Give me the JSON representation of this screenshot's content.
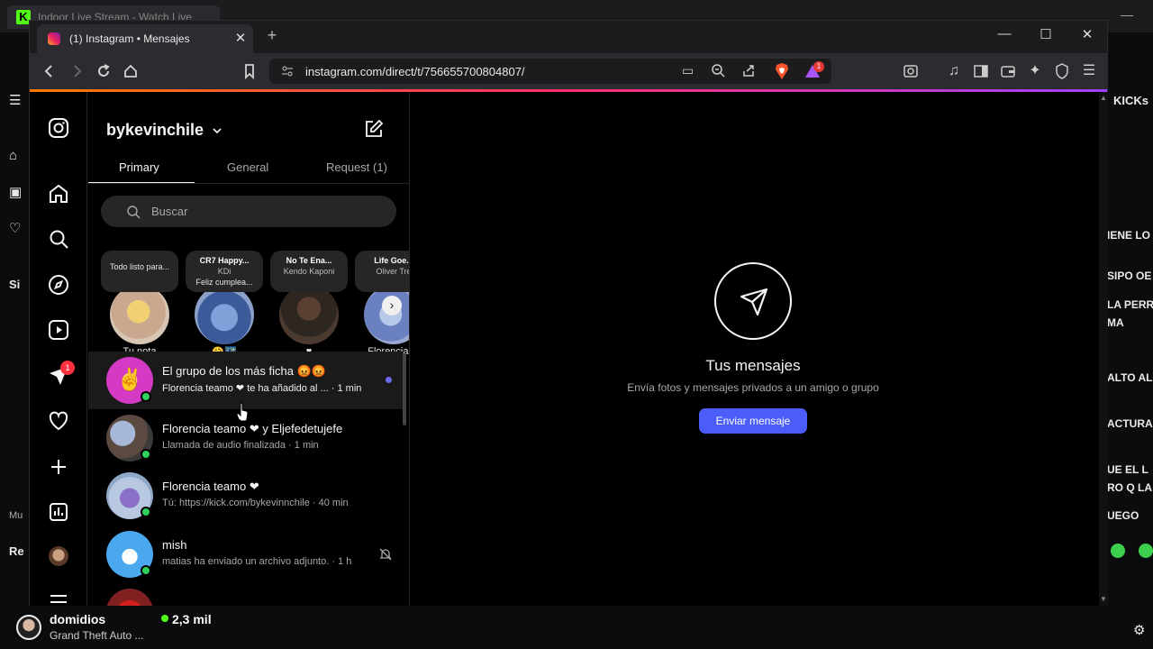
{
  "background": {
    "tab_title": "Indoor Live Stream - Watch Live",
    "tab_logo": "K",
    "chat_lines": [
      "KICKs",
      "IENE LO",
      "SIPO OE",
      "LA PERR",
      "MA",
      "ALTO AL",
      "ACTURA",
      "UE EL L",
      "RO Q LA",
      "UEGO"
    ],
    "left_labels": [
      "Si",
      "Mu",
      "Re"
    ],
    "streamer": {
      "name": "domidios",
      "game": "Grand Theft Auto ...",
      "viewers": "2,3 mil"
    },
    "accent": "#53fc18"
  },
  "browser": {
    "tab_title": "(1) Instagram • Mensajes",
    "url": "instagram.com/direct/t/756655700804807/",
    "notification_badge": "1"
  },
  "instagram": {
    "username": "bykevinchile",
    "tabs": [
      "Primary",
      "General",
      "Request (1)"
    ],
    "search_placeholder": "Buscar",
    "rail_badge": "1",
    "notes": [
      {
        "title": "Todo listo para...",
        "sub": "",
        "extra": "",
        "label": "Tu nota"
      },
      {
        "title": "CR7 Happy...",
        "sub": "KDi",
        "extra": "Feliz cumplea...",
        "label": "🤗🌃"
      },
      {
        "title": "No Te Ena...",
        "sub": "Kendo Kaponi",
        "extra": "",
        "label": "♥"
      },
      {
        "title": "Life Goe...",
        "sub": "Oliver Tre",
        "extra": "",
        "label": "Florencia te"
      }
    ],
    "conversations": [
      {
        "name": "El grupo de los más ficha 😡😡",
        "preview": "Florencia teamo ❤ te ha añadido al ... · 1 min"
      },
      {
        "name": "Florencia teamo ❤ y Eljefedetujefe",
        "preview": "Llamada de audio finalizada · 1 min"
      },
      {
        "name": "Florencia teamo ❤",
        "preview": "Tú: https://kick.com/bykevinnchile · 40 min"
      },
      {
        "name": "mish",
        "preview": "matias ha enviado un archivo adjunto. · 1 h"
      }
    ],
    "empty_state": {
      "title": "Tus mensajes",
      "subtitle": "Envía fotos y mensajes privados a un amigo o grupo",
      "button": "Enviar mensaje"
    },
    "accent": "#4a5df9"
  }
}
